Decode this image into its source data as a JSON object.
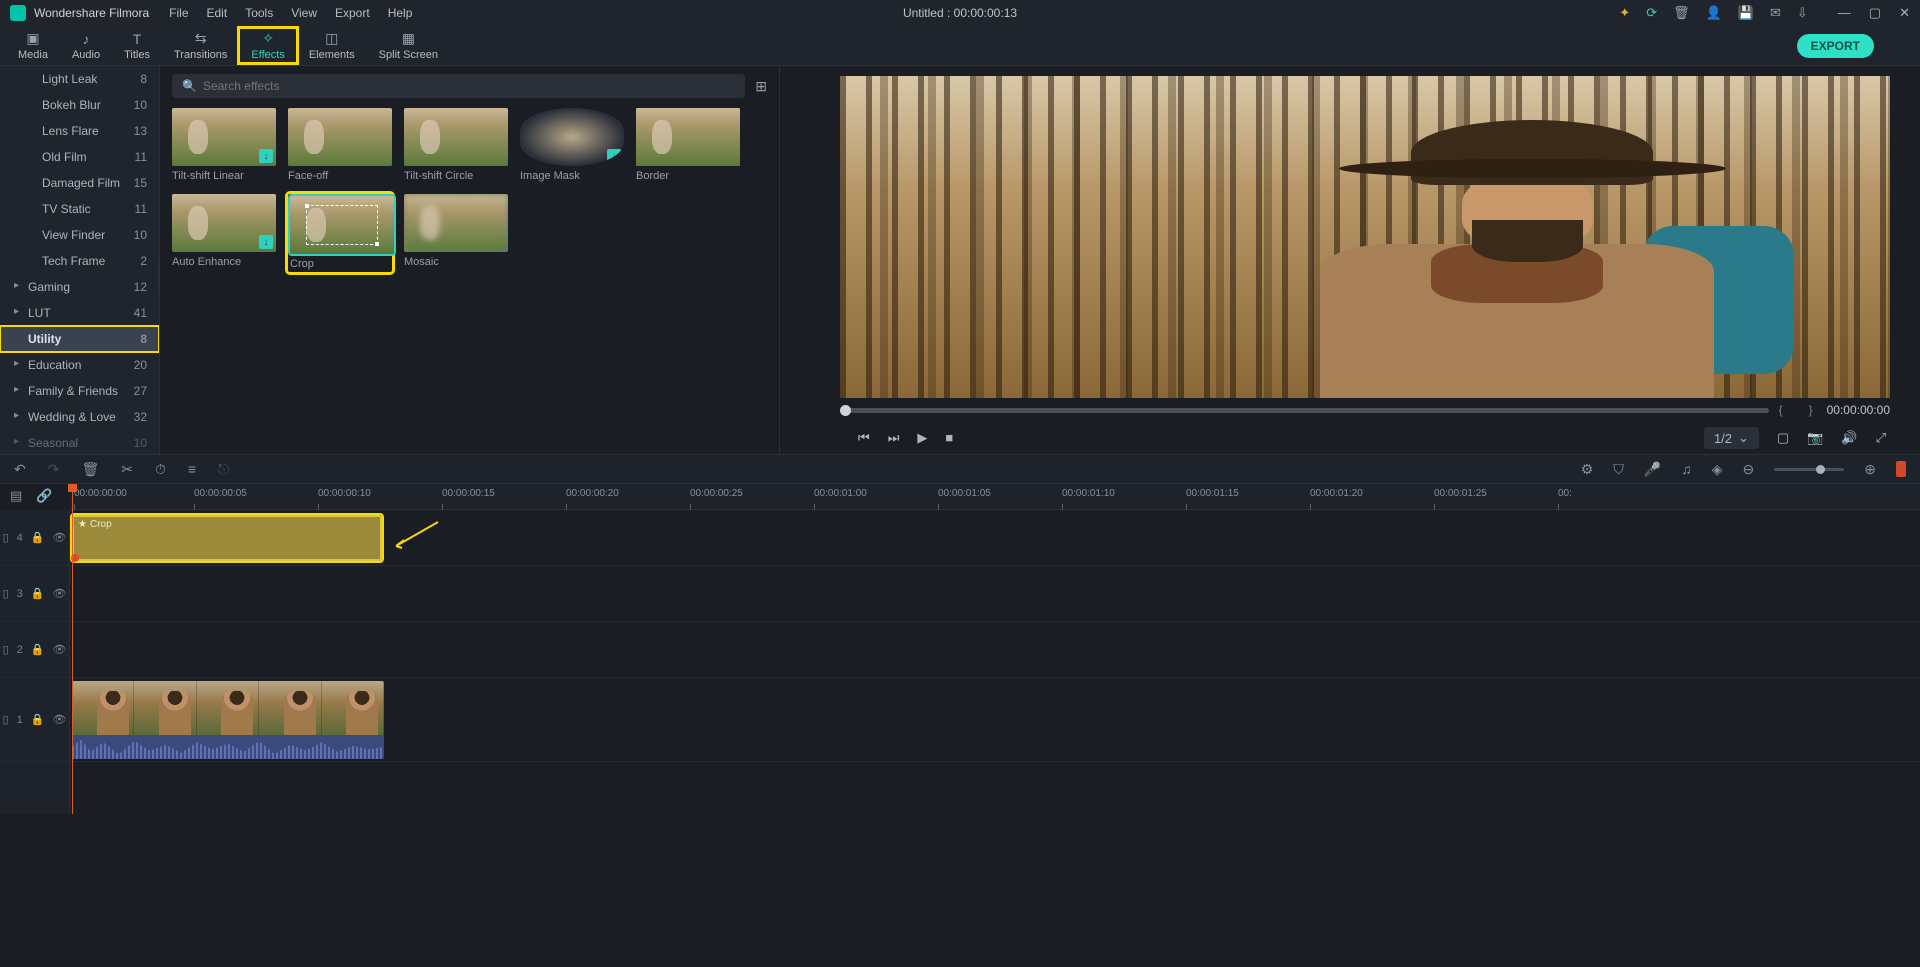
{
  "titlebar": {
    "app_name": "Wondershare Filmora",
    "menu": [
      "File",
      "Edit",
      "Tools",
      "View",
      "Export",
      "Help"
    ],
    "project_title": "Untitled : 00:00:00:13"
  },
  "tabs": {
    "items": [
      {
        "label": "Media",
        "icon": "folder"
      },
      {
        "label": "Audio",
        "icon": "music"
      },
      {
        "label": "Titles",
        "icon": "T"
      },
      {
        "label": "Transitions",
        "icon": "swap"
      },
      {
        "label": "Effects",
        "icon": "wand",
        "active": true,
        "highlighted": true
      },
      {
        "label": "Elements",
        "icon": "layers"
      },
      {
        "label": "Split Screen",
        "icon": "grid"
      }
    ],
    "export_label": "EXPORT"
  },
  "sidebar": {
    "categories": [
      {
        "name": "Light Leak",
        "count": 8,
        "indent": true
      },
      {
        "name": "Bokeh Blur",
        "count": 10,
        "indent": true
      },
      {
        "name": "Lens Flare",
        "count": 13,
        "indent": true
      },
      {
        "name": "Old Film",
        "count": 11,
        "indent": true
      },
      {
        "name": "Damaged Film",
        "count": 15,
        "indent": true
      },
      {
        "name": "TV Static",
        "count": 11,
        "indent": true
      },
      {
        "name": "View Finder",
        "count": 10,
        "indent": true
      },
      {
        "name": "Tech Frame",
        "count": 2,
        "indent": true
      },
      {
        "name": "Gaming",
        "count": 12,
        "expandable": true
      },
      {
        "name": "LUT",
        "count": 41,
        "expandable": true
      },
      {
        "name": "Utility",
        "count": 8,
        "active": true
      },
      {
        "name": "Education",
        "count": 20,
        "expandable": true
      },
      {
        "name": "Family & Friends",
        "count": 27,
        "expandable": true
      },
      {
        "name": "Wedding & Love",
        "count": 32,
        "expandable": true
      },
      {
        "name": "Seasonal",
        "count": 10,
        "expandable": true
      }
    ]
  },
  "search": {
    "placeholder": "Search effects"
  },
  "effects": [
    {
      "label": "Tilt-shift Linear",
      "dl": true
    },
    {
      "label": "Face-off"
    },
    {
      "label": "Tilt-shift Circle"
    },
    {
      "label": "Image Mask",
      "mask": true,
      "dl": true
    },
    {
      "label": "Border",
      "border": true
    },
    {
      "label": "Auto Enhance",
      "dl": true
    },
    {
      "label": "Crop",
      "selected": true
    },
    {
      "label": "Mosaic"
    }
  ],
  "preview": {
    "timecode": "00:00:00:00",
    "ratio": "1/2"
  },
  "ruler": {
    "ticks": [
      "00:00:00:00",
      "00:00:00:05",
      "00:00:00:10",
      "00:00:00:15",
      "00:00:00:20",
      "00:00:00:25",
      "00:00:01:00",
      "00:00:01:05",
      "00:00:01:10",
      "00:00:01:15",
      "00:00:01:20",
      "00:00:01:25",
      "00:"
    ]
  },
  "tracks": {
    "labels": [
      "4",
      "3",
      "2",
      "1"
    ],
    "effect_clip_label": "Crop"
  }
}
